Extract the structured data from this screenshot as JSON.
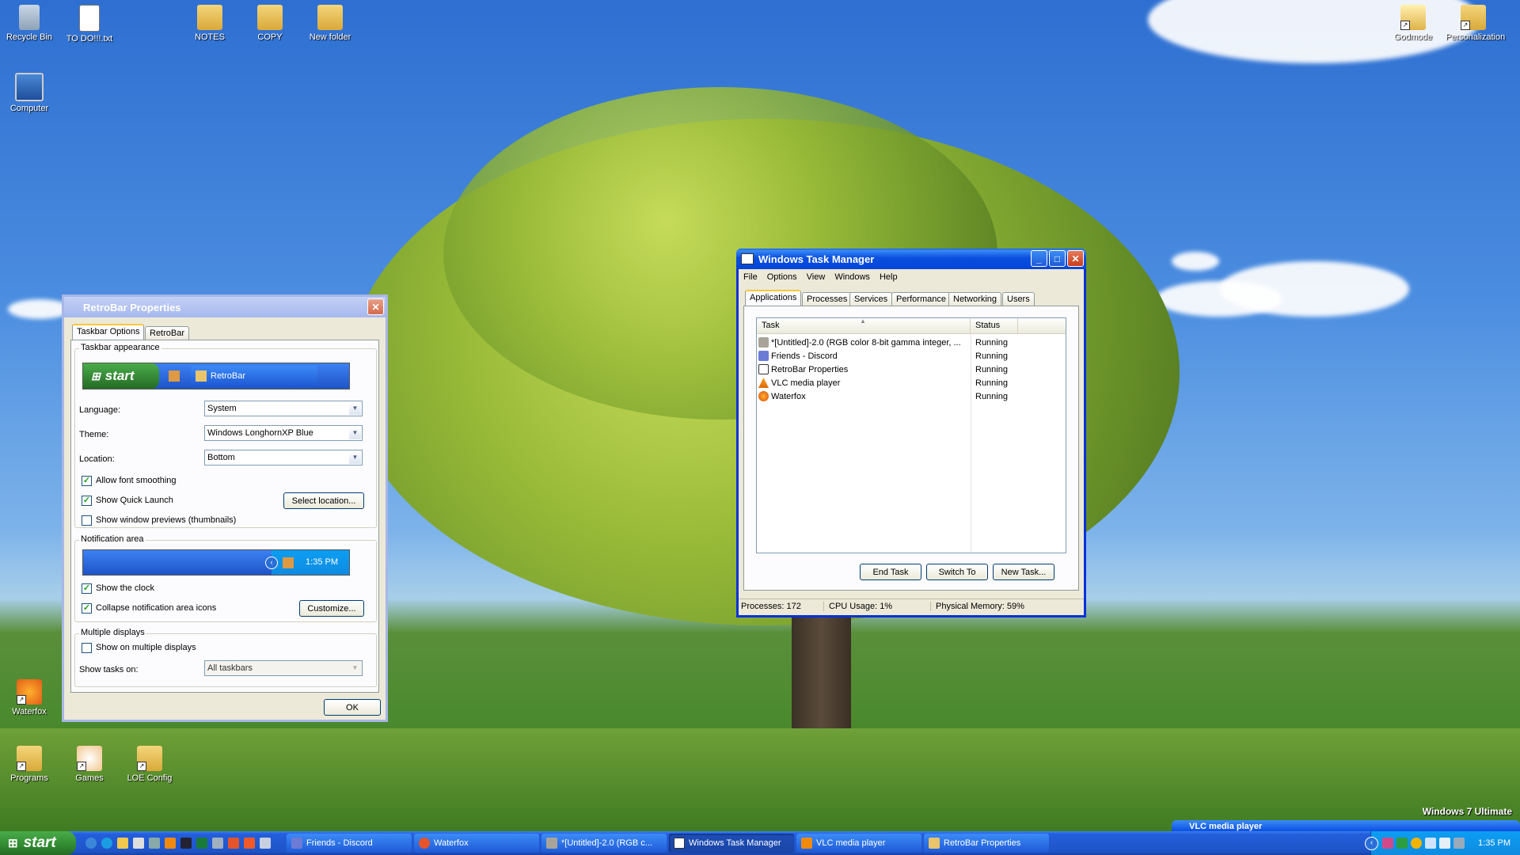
{
  "desktop": {
    "icons": [
      {
        "label": "Recycle Bin"
      },
      {
        "label": "TO DO!!!.txt"
      },
      {
        "label": "NOTES"
      },
      {
        "label": "COPY"
      },
      {
        "label": "New folder"
      },
      {
        "label": "Computer"
      },
      {
        "label": "Godmode"
      },
      {
        "label": "Personalization"
      },
      {
        "label": "Waterfox"
      },
      {
        "label": "Programs"
      },
      {
        "label": "Games"
      },
      {
        "label": "LOE Config"
      }
    ],
    "watermark": "Windows 7 Ultimate"
  },
  "retrobar": {
    "title": "RetroBar Properties",
    "tabs": [
      "Taskbar Options",
      "RetroBar"
    ],
    "taskbar_appearance": {
      "group_label": "Taskbar appearance",
      "preview_start": "start",
      "preview_task": "RetroBar"
    },
    "language": {
      "label": "Language:",
      "value": "System"
    },
    "theme": {
      "label": "Theme:",
      "value": "Windows LonghornXP Blue"
    },
    "location": {
      "label": "Location:",
      "value": "Bottom"
    },
    "allow_font_smoothing": {
      "label": "Allow font smoothing",
      "checked": true
    },
    "show_quick_launch": {
      "label": "Show Quick Launch",
      "checked": true
    },
    "select_location_button": "Select location...",
    "show_window_previews": {
      "label": "Show window previews (thumbnails)",
      "checked": false
    },
    "notification_area": {
      "group_label": "Notification area",
      "preview_clock": "1:35 PM"
    },
    "show_clock": {
      "label": "Show the clock",
      "checked": true
    },
    "collapse_icons": {
      "label": "Collapse notification area icons",
      "checked": true
    },
    "customize_button": "Customize...",
    "multiple_displays": {
      "group_label": "Multiple displays"
    },
    "show_on_multiple": {
      "label": "Show on multiple displays",
      "checked": false
    },
    "show_tasks_on": {
      "label": "Show tasks on:",
      "value": "All taskbars"
    },
    "ok_button": "OK"
  },
  "taskmgr": {
    "title": "Windows Task Manager",
    "menu": [
      "File",
      "Options",
      "View",
      "Windows",
      "Help"
    ],
    "tabs": [
      "Applications",
      "Processes",
      "Services",
      "Performance",
      "Networking",
      "Users"
    ],
    "columns": {
      "task": "Task",
      "status": "Status"
    },
    "rows": [
      {
        "task": "*[Untitled]-2.0 (RGB color 8-bit gamma integer, ...",
        "status": "Running"
      },
      {
        "task": "Friends - Discord",
        "status": "Running"
      },
      {
        "task": "RetroBar Properties",
        "status": "Running"
      },
      {
        "task": "VLC media player",
        "status": "Running"
      },
      {
        "task": "Waterfox",
        "status": "Running"
      }
    ],
    "buttons": {
      "end_task": "End Task",
      "switch_to": "Switch To",
      "new_task": "New Task..."
    },
    "status_bar": {
      "processes": "Processes: 172",
      "cpu": "CPU Usage: 1%",
      "memory": "Physical Memory: 59%"
    }
  },
  "taskbar": {
    "start_label": "start",
    "tasks": [
      {
        "label": "Friends - Discord"
      },
      {
        "label": "Waterfox"
      },
      {
        "label": "*[Untitled]-2.0 (RGB c..."
      },
      {
        "label": "Windows Task Manager"
      },
      {
        "label": "VLC media player"
      },
      {
        "label": "RetroBar Properties"
      }
    ],
    "clock": "1:35 PM",
    "vlc_peek": "VLC media player"
  }
}
